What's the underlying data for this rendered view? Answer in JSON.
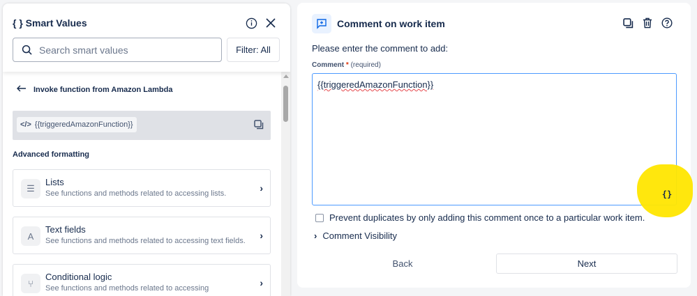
{
  "smart_values": {
    "title": "{ } Smart Values",
    "search_placeholder": "Search smart values",
    "filter_label": "Filter:  All",
    "back_label": "Invoke function from Amazon Lambda",
    "value": "{{triggeredAmazonFunction}}",
    "section": "Advanced formatting",
    "cards": [
      {
        "icon": "list-icon",
        "glyph": "☰",
        "title": "Lists",
        "desc": "See functions and methods related to accessing lists."
      },
      {
        "icon": "text-icon",
        "glyph": "A",
        "title": "Text fields",
        "desc": "See functions and methods related to accessing text fields."
      },
      {
        "icon": "branch-icon",
        "glyph": "⑂",
        "title": "Conditional logic",
        "desc": "See functions and methods related to accessing"
      }
    ]
  },
  "action": {
    "title": "Comment on work item",
    "prompt": "Please enter the comment to add:",
    "field_label": "Comment",
    "required_mark": "*",
    "required_text": "(required)",
    "comment_value": "{{triggeredAmazonFunction}}",
    "smart_value_button": "{}",
    "prevent_duplicates": "Prevent duplicates by only adding this comment once to a particular work item.",
    "prevent_duplicates_checked": false,
    "visibility_label": "Comment Visibility",
    "back": "Back",
    "next": "Next"
  },
  "colors": {
    "accent": "#4c9aff",
    "highlight": "#ffe600"
  }
}
